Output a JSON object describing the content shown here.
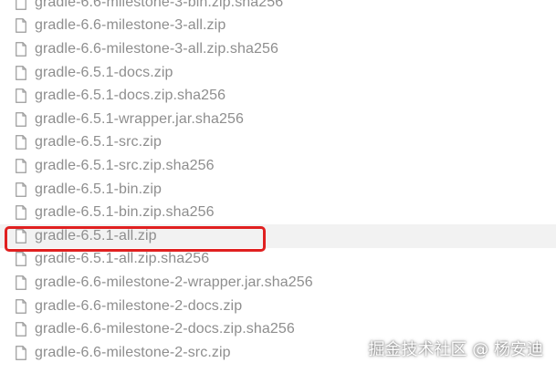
{
  "files": [
    {
      "name": "gradle-6.6-milestone-3-bin.zip.sha256"
    },
    {
      "name": "gradle-6.6-milestone-3-all.zip"
    },
    {
      "name": "gradle-6.6-milestone-3-all.zip.sha256"
    },
    {
      "name": "gradle-6.5.1-docs.zip"
    },
    {
      "name": "gradle-6.5.1-docs.zip.sha256"
    },
    {
      "name": "gradle-6.5.1-wrapper.jar.sha256"
    },
    {
      "name": "gradle-6.5.1-src.zip"
    },
    {
      "name": "gradle-6.5.1-src.zip.sha256"
    },
    {
      "name": "gradle-6.5.1-bin.zip"
    },
    {
      "name": "gradle-6.5.1-bin.zip.sha256"
    },
    {
      "name": "gradle-6.5.1-all.zip",
      "highlighted": true
    },
    {
      "name": "gradle-6.5.1-all.zip.sha256"
    },
    {
      "name": "gradle-6.6-milestone-2-wrapper.jar.sha256"
    },
    {
      "name": "gradle-6.6-milestone-2-docs.zip"
    },
    {
      "name": "gradle-6.6-milestone-2-docs.zip.sha256"
    },
    {
      "name": "gradle-6.6-milestone-2-src.zip"
    }
  ],
  "icon": "file-icon",
  "colors": {
    "link_text": "#8e8e8e",
    "highlight_row": "#f2f2f2",
    "selection_box": "#e02020"
  },
  "watermark": "掘金技术社区 @ 杨安迪"
}
